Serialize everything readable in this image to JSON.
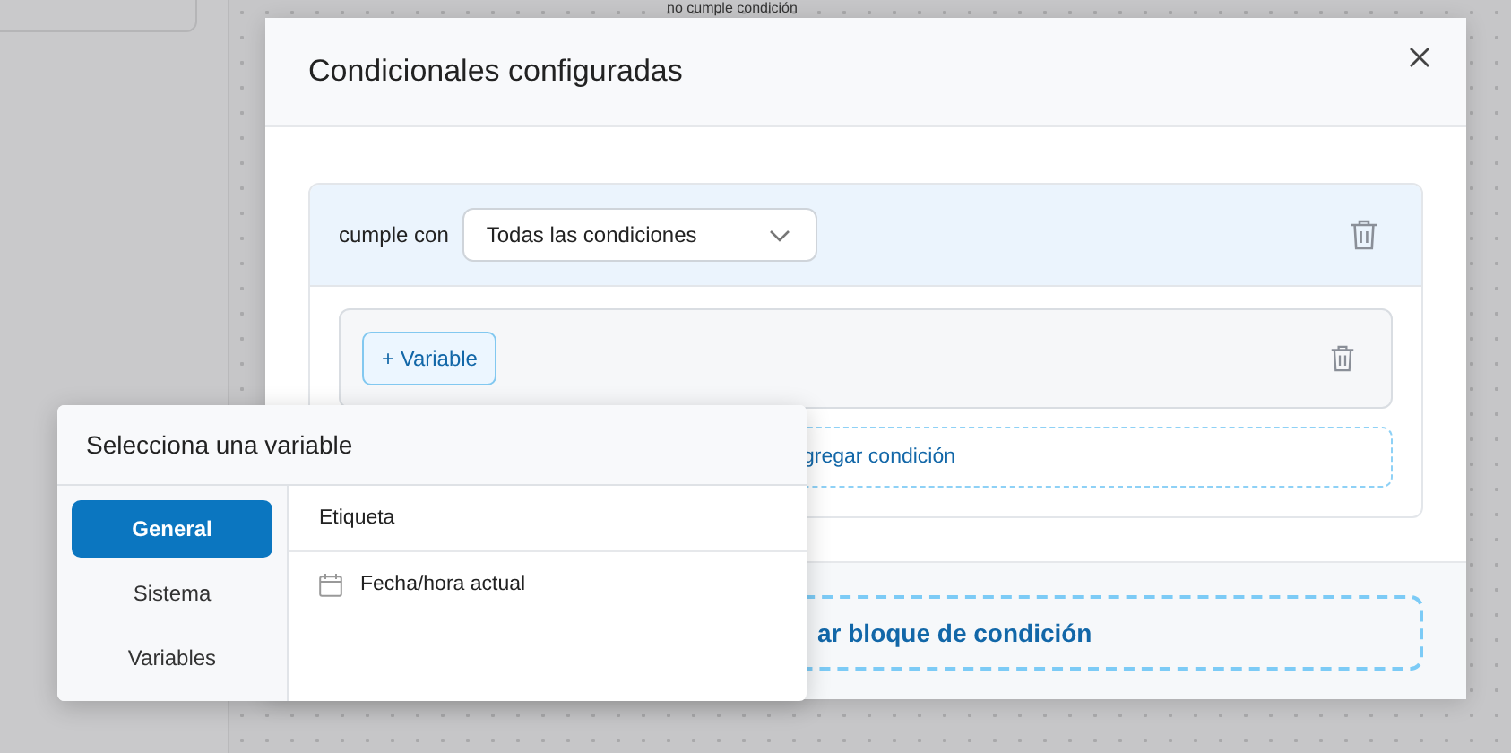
{
  "canvas_node": {
    "label": "no cumple condición"
  },
  "modal": {
    "title": "Condicionales configuradas",
    "block": {
      "match_label": "cumple con",
      "match_value": "Todas las condiciones",
      "condition": {
        "variable_button": "+ Variable"
      },
      "add_condition": "gregar condición"
    },
    "add_block": "ar bloque de condición"
  },
  "variable_picker": {
    "title": "Selecciona una variable",
    "categories": [
      {
        "label": "General",
        "selected": true
      },
      {
        "label": "Sistema",
        "selected": false
      },
      {
        "label": "Variables",
        "selected": false
      }
    ],
    "items": [
      {
        "label": "Etiqueta",
        "kind": "plain"
      },
      {
        "label": "Fecha/hora actual",
        "kind": "date"
      }
    ]
  }
}
